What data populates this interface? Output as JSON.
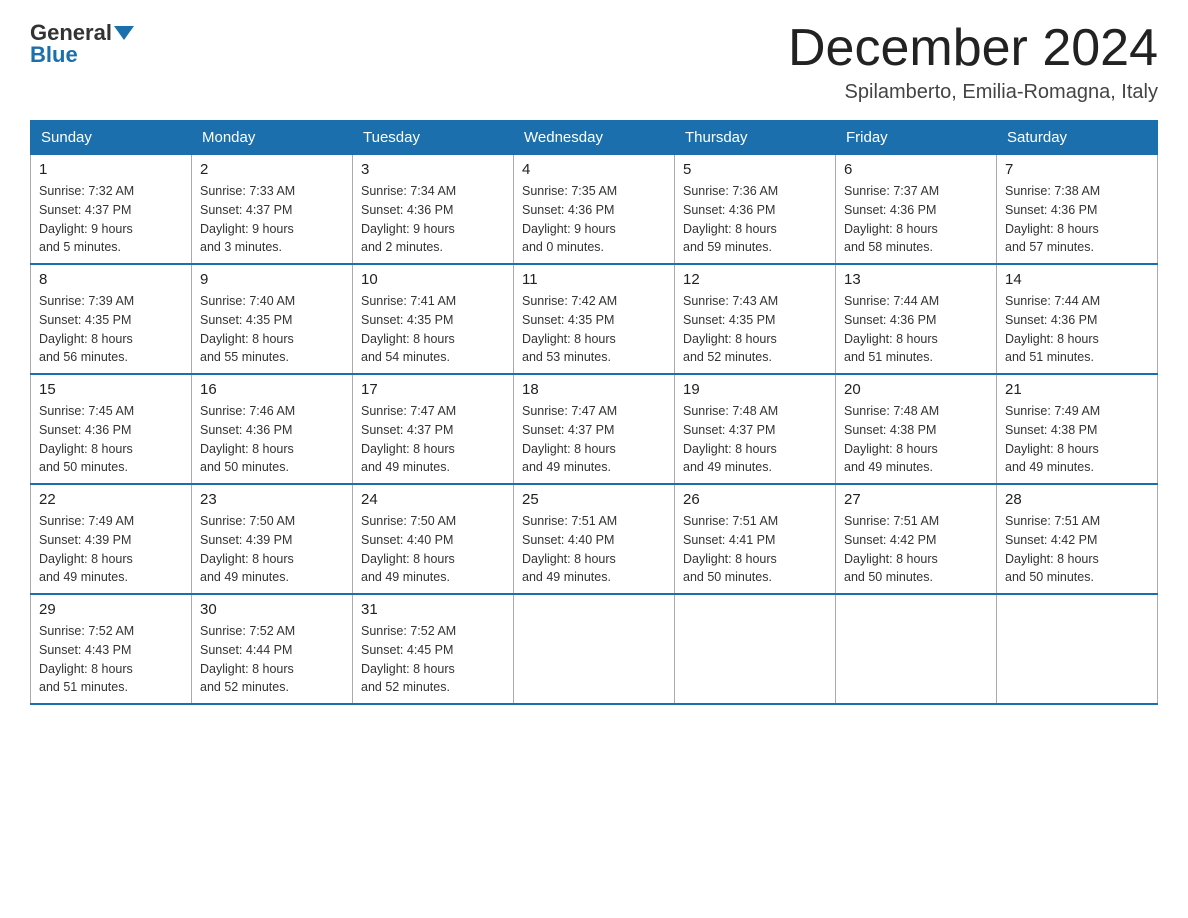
{
  "header": {
    "logo_general": "General",
    "logo_blue": "Blue",
    "month_title": "December 2024",
    "subtitle": "Spilamberto, Emilia-Romagna, Italy"
  },
  "days_of_week": [
    "Sunday",
    "Monday",
    "Tuesday",
    "Wednesday",
    "Thursday",
    "Friday",
    "Saturday"
  ],
  "weeks": [
    [
      {
        "day": "1",
        "sunrise": "7:32 AM",
        "sunset": "4:37 PM",
        "daylight": "9 hours and 5 minutes."
      },
      {
        "day": "2",
        "sunrise": "7:33 AM",
        "sunset": "4:37 PM",
        "daylight": "9 hours and 3 minutes."
      },
      {
        "day": "3",
        "sunrise": "7:34 AM",
        "sunset": "4:36 PM",
        "daylight": "9 hours and 2 minutes."
      },
      {
        "day": "4",
        "sunrise": "7:35 AM",
        "sunset": "4:36 PM",
        "daylight": "9 hours and 0 minutes."
      },
      {
        "day": "5",
        "sunrise": "7:36 AM",
        "sunset": "4:36 PM",
        "daylight": "8 hours and 59 minutes."
      },
      {
        "day": "6",
        "sunrise": "7:37 AM",
        "sunset": "4:36 PM",
        "daylight": "8 hours and 58 minutes."
      },
      {
        "day": "7",
        "sunrise": "7:38 AM",
        "sunset": "4:36 PM",
        "daylight": "8 hours and 57 minutes."
      }
    ],
    [
      {
        "day": "8",
        "sunrise": "7:39 AM",
        "sunset": "4:35 PM",
        "daylight": "8 hours and 56 minutes."
      },
      {
        "day": "9",
        "sunrise": "7:40 AM",
        "sunset": "4:35 PM",
        "daylight": "8 hours and 55 minutes."
      },
      {
        "day": "10",
        "sunrise": "7:41 AM",
        "sunset": "4:35 PM",
        "daylight": "8 hours and 54 minutes."
      },
      {
        "day": "11",
        "sunrise": "7:42 AM",
        "sunset": "4:35 PM",
        "daylight": "8 hours and 53 minutes."
      },
      {
        "day": "12",
        "sunrise": "7:43 AM",
        "sunset": "4:35 PM",
        "daylight": "8 hours and 52 minutes."
      },
      {
        "day": "13",
        "sunrise": "7:44 AM",
        "sunset": "4:36 PM",
        "daylight": "8 hours and 51 minutes."
      },
      {
        "day": "14",
        "sunrise": "7:44 AM",
        "sunset": "4:36 PM",
        "daylight": "8 hours and 51 minutes."
      }
    ],
    [
      {
        "day": "15",
        "sunrise": "7:45 AM",
        "sunset": "4:36 PM",
        "daylight": "8 hours and 50 minutes."
      },
      {
        "day": "16",
        "sunrise": "7:46 AM",
        "sunset": "4:36 PM",
        "daylight": "8 hours and 50 minutes."
      },
      {
        "day": "17",
        "sunrise": "7:47 AM",
        "sunset": "4:37 PM",
        "daylight": "8 hours and 49 minutes."
      },
      {
        "day": "18",
        "sunrise": "7:47 AM",
        "sunset": "4:37 PM",
        "daylight": "8 hours and 49 minutes."
      },
      {
        "day": "19",
        "sunrise": "7:48 AM",
        "sunset": "4:37 PM",
        "daylight": "8 hours and 49 minutes."
      },
      {
        "day": "20",
        "sunrise": "7:48 AM",
        "sunset": "4:38 PM",
        "daylight": "8 hours and 49 minutes."
      },
      {
        "day": "21",
        "sunrise": "7:49 AM",
        "sunset": "4:38 PM",
        "daylight": "8 hours and 49 minutes."
      }
    ],
    [
      {
        "day": "22",
        "sunrise": "7:49 AM",
        "sunset": "4:39 PM",
        "daylight": "8 hours and 49 minutes."
      },
      {
        "day": "23",
        "sunrise": "7:50 AM",
        "sunset": "4:39 PM",
        "daylight": "8 hours and 49 minutes."
      },
      {
        "day": "24",
        "sunrise": "7:50 AM",
        "sunset": "4:40 PM",
        "daylight": "8 hours and 49 minutes."
      },
      {
        "day": "25",
        "sunrise": "7:51 AM",
        "sunset": "4:40 PM",
        "daylight": "8 hours and 49 minutes."
      },
      {
        "day": "26",
        "sunrise": "7:51 AM",
        "sunset": "4:41 PM",
        "daylight": "8 hours and 50 minutes."
      },
      {
        "day": "27",
        "sunrise": "7:51 AM",
        "sunset": "4:42 PM",
        "daylight": "8 hours and 50 minutes."
      },
      {
        "day": "28",
        "sunrise": "7:51 AM",
        "sunset": "4:42 PM",
        "daylight": "8 hours and 50 minutes."
      }
    ],
    [
      {
        "day": "29",
        "sunrise": "7:52 AM",
        "sunset": "4:43 PM",
        "daylight": "8 hours and 51 minutes."
      },
      {
        "day": "30",
        "sunrise": "7:52 AM",
        "sunset": "4:44 PM",
        "daylight": "8 hours and 52 minutes."
      },
      {
        "day": "31",
        "sunrise": "7:52 AM",
        "sunset": "4:45 PM",
        "daylight": "8 hours and 52 minutes."
      },
      null,
      null,
      null,
      null
    ]
  ],
  "labels": {
    "sunrise": "Sunrise:",
    "sunset": "Sunset:",
    "daylight": "Daylight:"
  }
}
